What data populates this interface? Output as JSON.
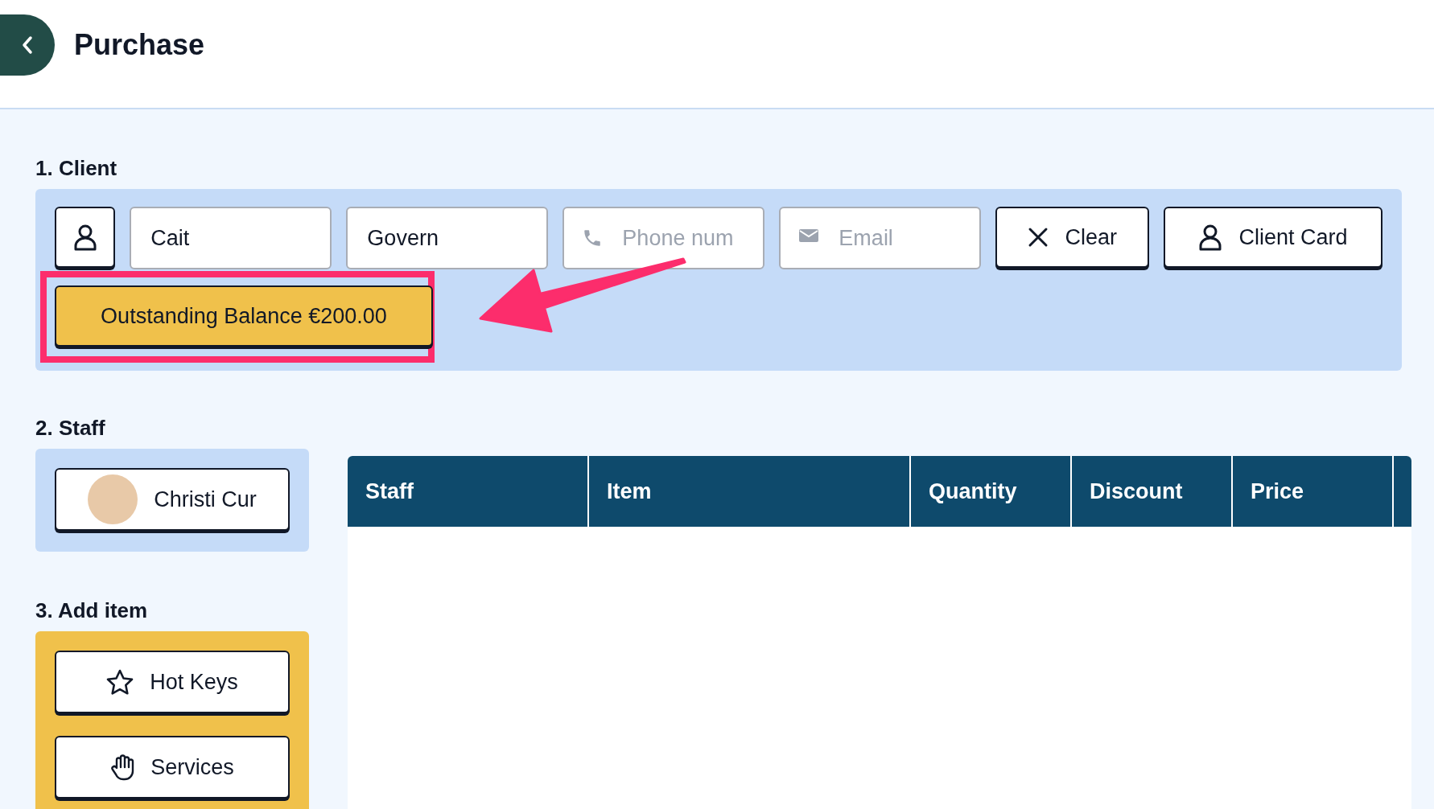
{
  "header": {
    "title": "Purchase"
  },
  "client": {
    "heading": "1. Client",
    "first_name": {
      "value": "Cait"
    },
    "last_name": {
      "value": "Govern"
    },
    "phone": {
      "placeholder": "Phone num"
    },
    "email": {
      "placeholder": "Email"
    },
    "buttons": [
      {
        "label": "Clear",
        "kind": "clear"
      },
      {
        "label": "Client Card",
        "kind": "card"
      }
    ],
    "balance": {
      "label": "Outstanding Balance €200.00"
    }
  },
  "staff": {
    "heading": "2. Staff",
    "members": [
      {
        "name": "Christi Cur"
      }
    ]
  },
  "add_item": {
    "heading": "3. Add item",
    "buttons": [
      {
        "label": "Hot Keys",
        "kind": "hotkeys"
      },
      {
        "label": "Services",
        "kind": "services"
      }
    ]
  },
  "table": {
    "columns": [
      "Staff",
      "Item",
      "Quantity",
      "Discount",
      "Price"
    ]
  }
}
